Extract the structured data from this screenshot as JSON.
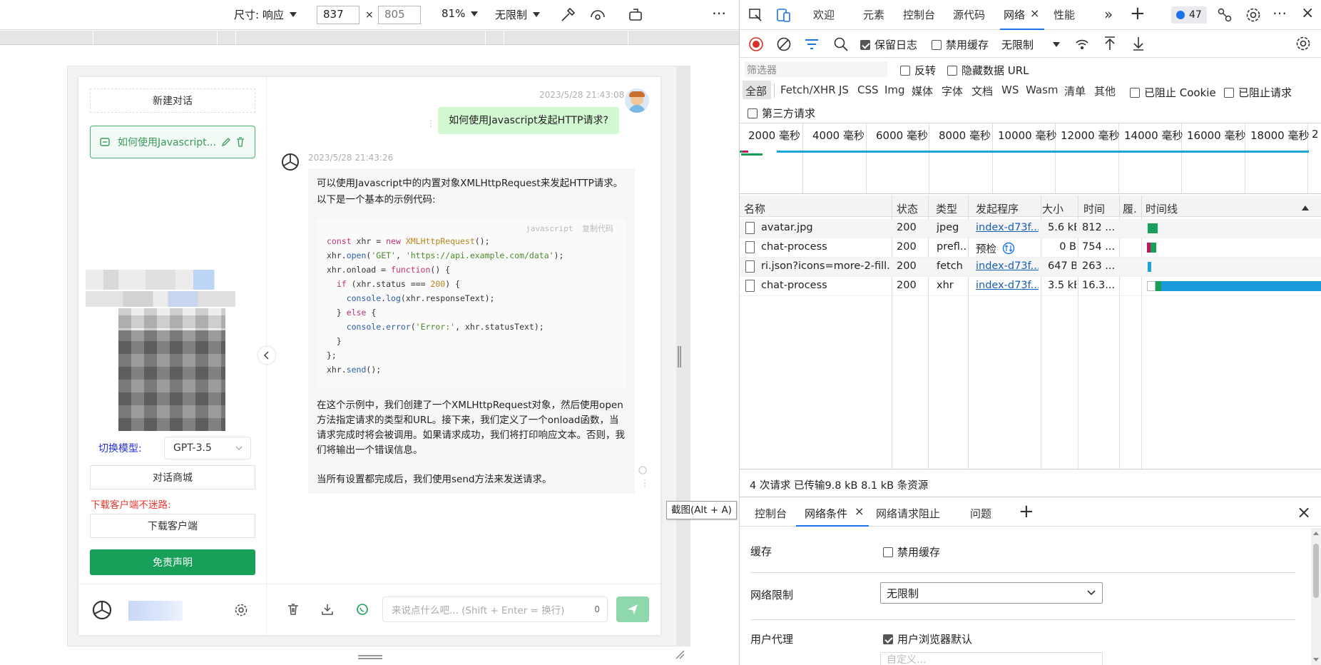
{
  "device_toolbar": {
    "dimensions_label": "尺寸: 响应",
    "width": "837",
    "times": "×",
    "height": "805",
    "zoom": "81%",
    "throttle": "无限制",
    "more": "⋯"
  },
  "app": {
    "new_chat": "新建对话",
    "chat_item": "如何使用Javascript...",
    "switch_model_label": "切换模型:",
    "model": "GPT-3.5",
    "store_button": "对话商城",
    "download_hint": "下载客户端不迷路:",
    "download_button": "下载客户端",
    "disclaimer_button": "免责声明",
    "user_time": "2023/5/28 21:43:08",
    "user_message": "如何使用Javascript发起HTTP请求?",
    "bot_time": "2023/5/28 21:43:26",
    "bot_intro_1": "可以使用Javascript中的内置对象XMLHttpRequest来发起HTTP请求。",
    "bot_intro_2": "以下是一个基本的示例代码:",
    "code_lang": "javascript",
    "code_copy": "复制代码",
    "bot_para_1": "在这个示例中，我们创建了一个XMLHttpRequest对象，然后使用open方法指定请求的类型和URL。接下来，我们定义了一个onload函数，当请求完成时将会被调用。如果请求成功，我们将打印响应文本。否则，我们将输出一个错误信息。",
    "bot_para_2": "当所有设置都完成后，我们使用send方法来发送请求。",
    "input_placeholder": "来说点什么吧... (Shift + Enter = 换行)",
    "input_count": "0",
    "tooltip": "截图(Alt + A)"
  },
  "devtools": {
    "tabs": [
      "欢迎",
      "元素",
      "控制台",
      "源代码",
      "网络",
      "性能"
    ],
    "issues_count": "47",
    "preserve_log": "保留日志",
    "disable_cache": "禁用缓存",
    "throttle": "无限制",
    "filter_placeholder": "筛选器",
    "invert": "反转",
    "hide_data_url": "隐藏数据 URL",
    "types": [
      "全部",
      "Fetch/XHR",
      "JS",
      "CSS",
      "Img",
      "媒体",
      "字体",
      "文档",
      "WS",
      "Wasm",
      "清单",
      "其他"
    ],
    "blocked_cookies": "已阻止 Cookie",
    "blocked_requests": "已阻止请求",
    "third_party": "第三方请求",
    "timeline_ticks": [
      "2000 毫秒",
      "4000 毫秒",
      "6000 毫秒",
      "8000 毫秒",
      "10000 毫秒",
      "12000 毫秒",
      "14000 毫秒",
      "16000 毫秒",
      "18000 毫秒",
      "2"
    ],
    "columns": [
      "名称",
      "状态",
      "类型",
      "发起程序",
      "大小",
      "时间",
      "履.",
      "时间线"
    ],
    "rows": [
      {
        "name": "avatar.jpg",
        "status": "200",
        "type": "jpeg",
        "initiator": "index-d73f...",
        "size": "5.6 kB",
        "time": "812 ..."
      },
      {
        "name": "chat-process",
        "status": "200",
        "type": "prefl...",
        "initiator": "预检",
        "size": "0 B",
        "time": "754 ..."
      },
      {
        "name": "ri.json?icons=more-2-fill...",
        "status": "200",
        "type": "fetch",
        "initiator": "index-d73f...",
        "size": "647 B",
        "time": "263 ..."
      },
      {
        "name": "chat-process",
        "status": "200",
        "type": "xhr",
        "initiator": "index-d73f...",
        "size": "3.5 kB",
        "time": "16.3..."
      }
    ],
    "summary": "4 次请求  已传输9.8 kB  8.1 kB 条资源",
    "drawer_tabs": [
      "控制台",
      "网络条件",
      "网络请求阻止",
      "问题"
    ],
    "cache_label": "缓存",
    "cache_checkbox": "禁用缓存",
    "network_label": "网络限制",
    "network_value": "无限制",
    "ua_label": "用户代理",
    "ua_checkbox": "用户浏览器默认",
    "ua_custom": "自定义..."
  }
}
